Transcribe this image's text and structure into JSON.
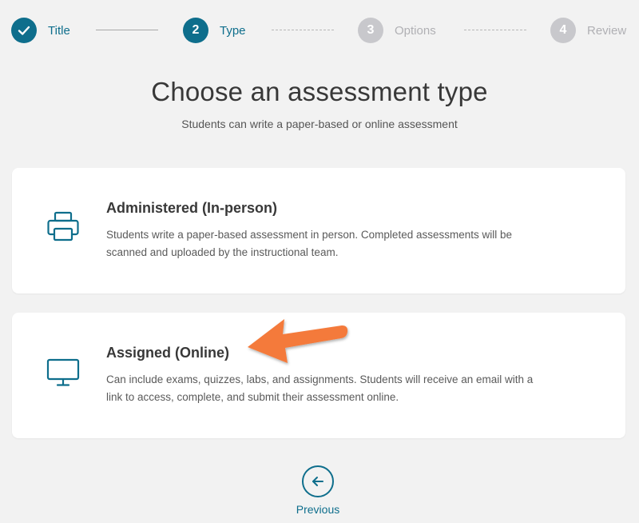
{
  "stepper": {
    "steps": [
      {
        "number": "",
        "label": "Title",
        "state": "complete"
      },
      {
        "number": "2",
        "label": "Type",
        "state": "active"
      },
      {
        "number": "3",
        "label": "Options",
        "state": "inactive"
      },
      {
        "number": "4",
        "label": "Review",
        "state": "inactive"
      }
    ]
  },
  "header": {
    "title": "Choose an assessment type",
    "subtitle": "Students can write a paper-based or online assessment"
  },
  "options": [
    {
      "title": "Administered (In-person)",
      "description": "Students write a paper-based assessment in person. Completed assessments will be scanned and uploaded by the instructional team.",
      "icon": "printer-icon"
    },
    {
      "title": "Assigned (Online)",
      "description": "Can include exams, quizzes, labs, and assignments. Students will receive an email with a link to access, complete, and submit their assessment online.",
      "icon": "monitor-icon"
    }
  ],
  "footer": {
    "previous_label": "Previous"
  },
  "colors": {
    "accent": "#0e6e8c",
    "inactive": "#c8c8cc",
    "annotation": "#f47a3a",
    "background": "#f2f2f2"
  }
}
